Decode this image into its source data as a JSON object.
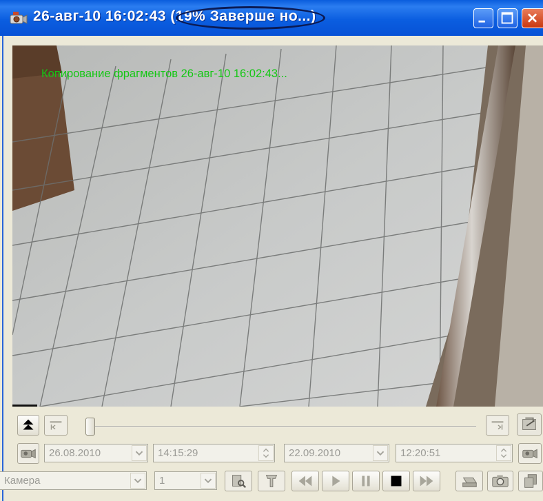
{
  "window": {
    "title_datetime": "26-авг-10 16:02:43",
    "title_progress": "(19% Заверше но...)"
  },
  "video": {
    "overlay_text": "Копирование фрагментов 26-авг-10 16:02:43..."
  },
  "controls": {
    "start_date": "26.08.2010",
    "start_time": "14:15:29",
    "end_date": "22.09.2010",
    "end_time": "12:20:51",
    "camera_placeholder": "Камера",
    "camera_number": "1",
    "slider_position": 0.0
  },
  "colors": {
    "titlebar": "#0a5ddd",
    "overlay_text": "#14c714",
    "window_bg": "#ece9d8"
  }
}
